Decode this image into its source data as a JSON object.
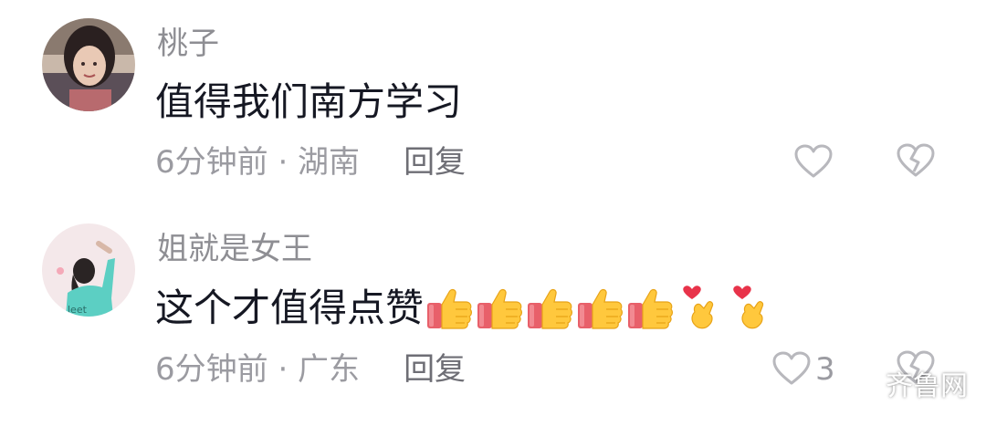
{
  "comments": [
    {
      "username": "桃子",
      "text": "值得我们南方学习",
      "time_location": "6分钟前 · 湖南",
      "reply_label": "回复",
      "like_count": "",
      "emojis": []
    },
    {
      "username": "姐就是女王",
      "text": "这个才值得点赞",
      "time_location": "6分钟前 · 广东",
      "reply_label": "回复",
      "like_count": "3",
      "emojis": [
        "thumbs-up",
        "thumbs-up",
        "thumbs-up",
        "thumbs-up",
        "thumbs-up",
        "finger-heart",
        "finger-heart"
      ]
    }
  ],
  "watermark": {
    "text": "齐鲁网",
    "icon": "wechat-icon"
  },
  "colors": {
    "text": "#161823",
    "secondary": "#9b9ba1",
    "icon_stroke": "#b8b8bd"
  }
}
